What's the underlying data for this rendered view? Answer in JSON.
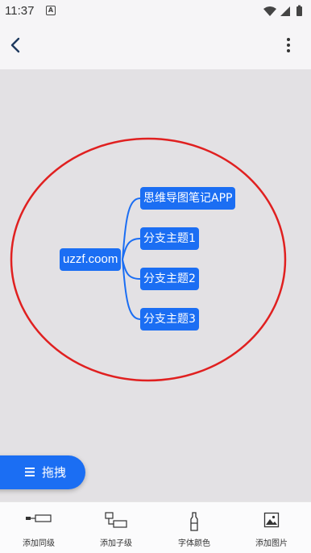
{
  "status_bar": {
    "time": "11:37",
    "notification_letter": "A"
  },
  "app_bar": {
    "back_icon": "chevron-left-icon",
    "more_icon": "more-vertical-icon"
  },
  "mindmap": {
    "root": "uzzf.coom",
    "branches": [
      "思维导图笔记APP",
      "分支主题1",
      "分支主题2",
      "分支主题3"
    ],
    "node_color": "#1b6ef3",
    "highlight_color": "#e02020"
  },
  "drag_button": {
    "label": "拖拽",
    "icon": "menu-icon"
  },
  "toolbar": {
    "items": [
      {
        "label": "添加同级",
        "icon": "add-sibling-icon"
      },
      {
        "label": "添加子级",
        "icon": "add-child-icon"
      },
      {
        "label": "字体颜色",
        "icon": "font-color-icon"
      },
      {
        "label": "添加图片",
        "icon": "add-image-icon"
      }
    ]
  }
}
